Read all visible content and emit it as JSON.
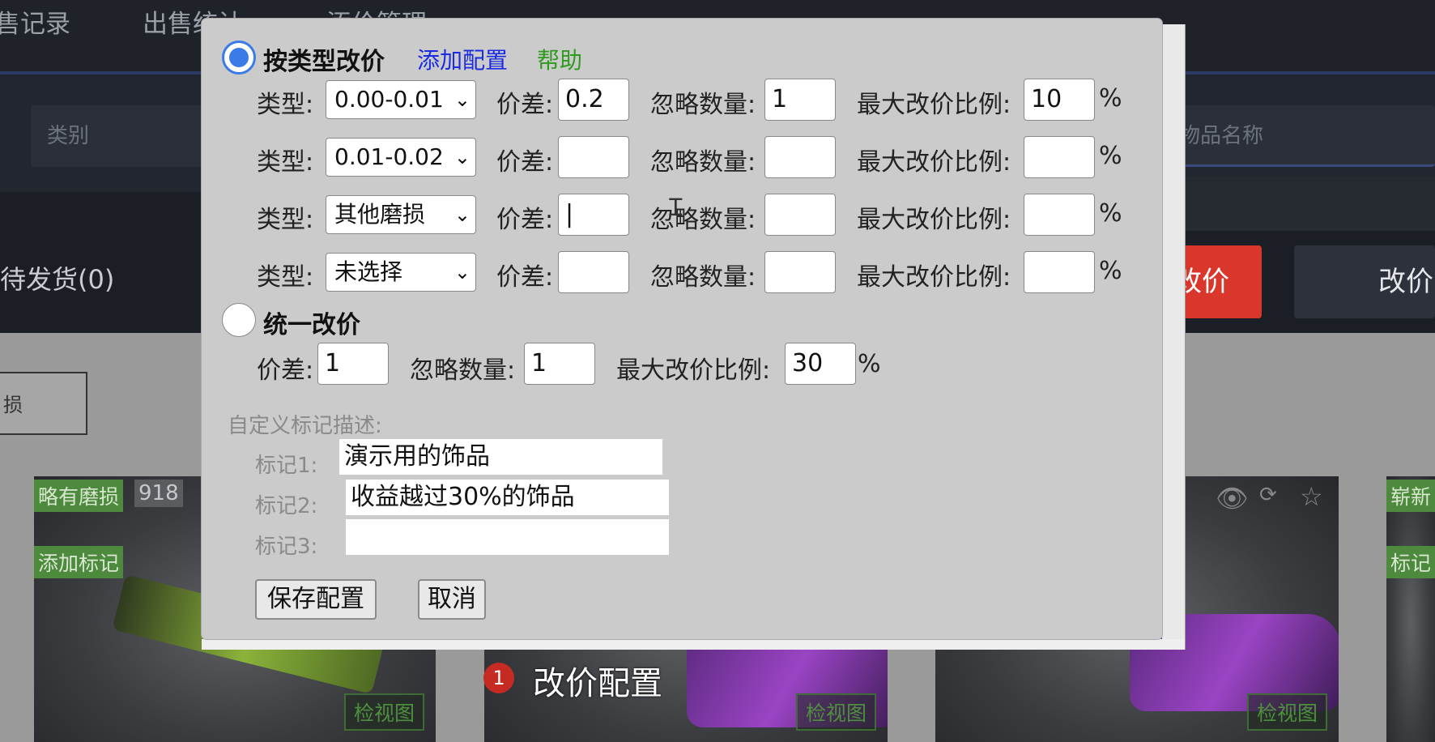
{
  "background": {
    "nav": [
      "售记录",
      "出售统计",
      "添价管理"
    ],
    "category_placeholder": "类别",
    "search_placeholder": "入物品名称",
    "pending_ship": "待发货(0)",
    "red_button": "改价",
    "gray_button": "改价",
    "wear_filter": "损",
    "cards": [
      {
        "wear": "略有磨损",
        "count": "918",
        "mark": "添加标记",
        "inspect": "检视图"
      },
      {
        "inspect": "检视图"
      },
      {
        "inspect": "检视图"
      },
      {
        "wear": "崭新",
        "mark": "标记"
      }
    ]
  },
  "dialog": {
    "by_type": {
      "label": "按类型改价",
      "selected": true,
      "add_config": "添加配置",
      "help": "帮助",
      "rows": [
        {
          "type_label": "类型:",
          "type": "0.00-0.01",
          "diff_label": "价差:",
          "diff": "0.2",
          "ignore_label": "忽略数量:",
          "ignore": "1",
          "max_label": "最大改价比例:",
          "max": "10",
          "pct": "%"
        },
        {
          "type_label": "类型:",
          "type": "0.01-0.02",
          "diff_label": "价差:",
          "diff": "",
          "ignore_label": "忽略数量:",
          "ignore": "",
          "max_label": "最大改价比例:",
          "max": "",
          "pct": "%"
        },
        {
          "type_label": "类型:",
          "type": "其他磨损",
          "diff_label": "价差:",
          "diff": "|",
          "ignore_label": "忽略数量:",
          "ignore": "",
          "max_label": "最大改价比例:",
          "max": "",
          "pct": "%"
        },
        {
          "type_label": "类型:",
          "type": "未选择",
          "diff_label": "价差:",
          "diff": "",
          "ignore_label": "忽略数量:",
          "ignore": "",
          "max_label": "最大改价比例:",
          "max": "",
          "pct": "%"
        }
      ]
    },
    "uniform": {
      "label": "统一改价",
      "selected": false,
      "diff_label": "价差:",
      "diff": "1",
      "ignore_label": "忽略数量:",
      "ignore": "1",
      "max_label": "最大改价比例:",
      "max": "30",
      "pct": "%"
    },
    "custom_marks": {
      "title": "自定义标记描述:",
      "marks": [
        {
          "label": "标记1:",
          "value": "演示用的饰品"
        },
        {
          "label": "标记2:",
          "value": "收益越过30%的饰品"
        },
        {
          "label": "标记3:",
          "value": ""
        }
      ]
    },
    "save": "保存配置",
    "cancel": "取消"
  },
  "caption": {
    "step": "1",
    "text": "改价配置"
  },
  "colors": {
    "link_blue": "#1a2be0",
    "help_green": "#2f9a1f",
    "radio_blue": "#3b7be8",
    "danger_red": "#d9362c",
    "tag_green": "#4e8a3e"
  }
}
